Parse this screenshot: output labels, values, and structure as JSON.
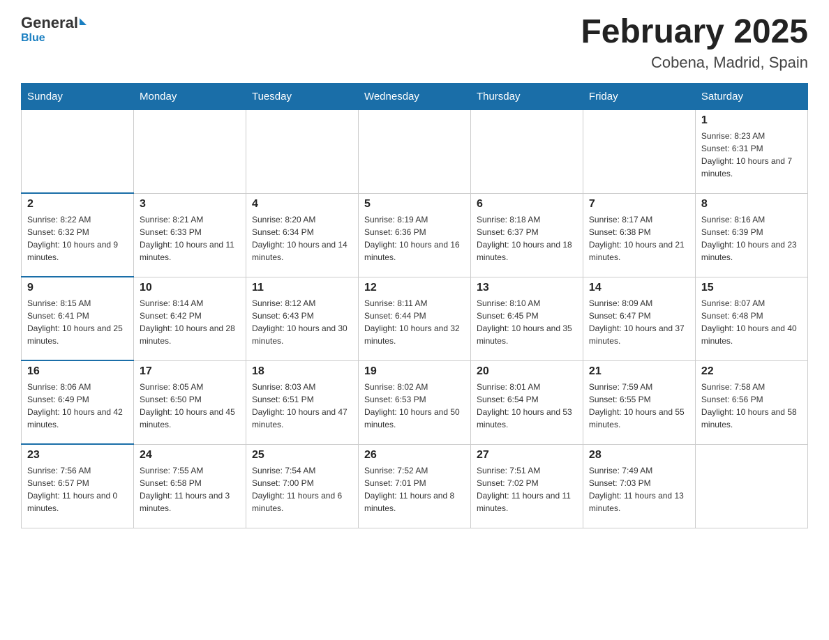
{
  "logo": {
    "general": "General",
    "blue": "Blue"
  },
  "title": "February 2025",
  "location": "Cobena, Madrid, Spain",
  "weekdays": [
    "Sunday",
    "Monday",
    "Tuesday",
    "Wednesday",
    "Thursday",
    "Friday",
    "Saturday"
  ],
  "weeks": [
    [
      {
        "day": "",
        "info": ""
      },
      {
        "day": "",
        "info": ""
      },
      {
        "day": "",
        "info": ""
      },
      {
        "day": "",
        "info": ""
      },
      {
        "day": "",
        "info": ""
      },
      {
        "day": "",
        "info": ""
      },
      {
        "day": "1",
        "info": "Sunrise: 8:23 AM\nSunset: 6:31 PM\nDaylight: 10 hours and 7 minutes."
      }
    ],
    [
      {
        "day": "2",
        "info": "Sunrise: 8:22 AM\nSunset: 6:32 PM\nDaylight: 10 hours and 9 minutes."
      },
      {
        "day": "3",
        "info": "Sunrise: 8:21 AM\nSunset: 6:33 PM\nDaylight: 10 hours and 11 minutes."
      },
      {
        "day": "4",
        "info": "Sunrise: 8:20 AM\nSunset: 6:34 PM\nDaylight: 10 hours and 14 minutes."
      },
      {
        "day": "5",
        "info": "Sunrise: 8:19 AM\nSunset: 6:36 PM\nDaylight: 10 hours and 16 minutes."
      },
      {
        "day": "6",
        "info": "Sunrise: 8:18 AM\nSunset: 6:37 PM\nDaylight: 10 hours and 18 minutes."
      },
      {
        "day": "7",
        "info": "Sunrise: 8:17 AM\nSunset: 6:38 PM\nDaylight: 10 hours and 21 minutes."
      },
      {
        "day": "8",
        "info": "Sunrise: 8:16 AM\nSunset: 6:39 PM\nDaylight: 10 hours and 23 minutes."
      }
    ],
    [
      {
        "day": "9",
        "info": "Sunrise: 8:15 AM\nSunset: 6:41 PM\nDaylight: 10 hours and 25 minutes."
      },
      {
        "day": "10",
        "info": "Sunrise: 8:14 AM\nSunset: 6:42 PM\nDaylight: 10 hours and 28 minutes."
      },
      {
        "day": "11",
        "info": "Sunrise: 8:12 AM\nSunset: 6:43 PM\nDaylight: 10 hours and 30 minutes."
      },
      {
        "day": "12",
        "info": "Sunrise: 8:11 AM\nSunset: 6:44 PM\nDaylight: 10 hours and 32 minutes."
      },
      {
        "day": "13",
        "info": "Sunrise: 8:10 AM\nSunset: 6:45 PM\nDaylight: 10 hours and 35 minutes."
      },
      {
        "day": "14",
        "info": "Sunrise: 8:09 AM\nSunset: 6:47 PM\nDaylight: 10 hours and 37 minutes."
      },
      {
        "day": "15",
        "info": "Sunrise: 8:07 AM\nSunset: 6:48 PM\nDaylight: 10 hours and 40 minutes."
      }
    ],
    [
      {
        "day": "16",
        "info": "Sunrise: 8:06 AM\nSunset: 6:49 PM\nDaylight: 10 hours and 42 minutes."
      },
      {
        "day": "17",
        "info": "Sunrise: 8:05 AM\nSunset: 6:50 PM\nDaylight: 10 hours and 45 minutes."
      },
      {
        "day": "18",
        "info": "Sunrise: 8:03 AM\nSunset: 6:51 PM\nDaylight: 10 hours and 47 minutes."
      },
      {
        "day": "19",
        "info": "Sunrise: 8:02 AM\nSunset: 6:53 PM\nDaylight: 10 hours and 50 minutes."
      },
      {
        "day": "20",
        "info": "Sunrise: 8:01 AM\nSunset: 6:54 PM\nDaylight: 10 hours and 53 minutes."
      },
      {
        "day": "21",
        "info": "Sunrise: 7:59 AM\nSunset: 6:55 PM\nDaylight: 10 hours and 55 minutes."
      },
      {
        "day": "22",
        "info": "Sunrise: 7:58 AM\nSunset: 6:56 PM\nDaylight: 10 hours and 58 minutes."
      }
    ],
    [
      {
        "day": "23",
        "info": "Sunrise: 7:56 AM\nSunset: 6:57 PM\nDaylight: 11 hours and 0 minutes."
      },
      {
        "day": "24",
        "info": "Sunrise: 7:55 AM\nSunset: 6:58 PM\nDaylight: 11 hours and 3 minutes."
      },
      {
        "day": "25",
        "info": "Sunrise: 7:54 AM\nSunset: 7:00 PM\nDaylight: 11 hours and 6 minutes."
      },
      {
        "day": "26",
        "info": "Sunrise: 7:52 AM\nSunset: 7:01 PM\nDaylight: 11 hours and 8 minutes."
      },
      {
        "day": "27",
        "info": "Sunrise: 7:51 AM\nSunset: 7:02 PM\nDaylight: 11 hours and 11 minutes."
      },
      {
        "day": "28",
        "info": "Sunrise: 7:49 AM\nSunset: 7:03 PM\nDaylight: 11 hours and 13 minutes."
      },
      {
        "day": "",
        "info": ""
      }
    ]
  ]
}
